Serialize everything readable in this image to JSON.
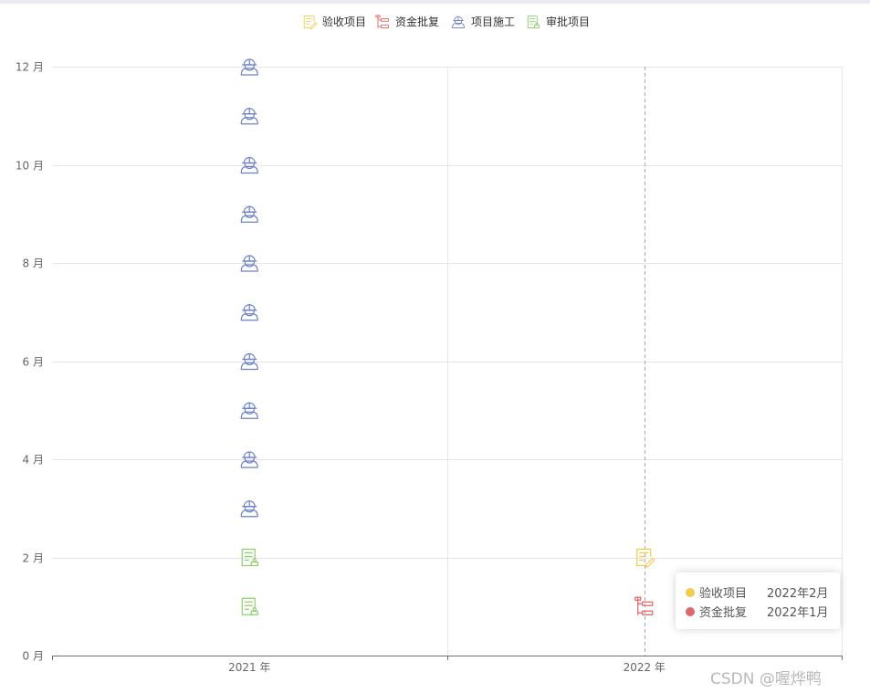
{
  "chart_data": {
    "type": "scatter",
    "legend": {
      "position": "top-center",
      "items": [
        {
          "name": "验收项目",
          "color": "#f1cc4a",
          "icon": "document-edit-icon"
        },
        {
          "name": "资金批复",
          "color": "#e06666",
          "icon": "tree-structure-icon"
        },
        {
          "name": "项目施工",
          "color": "#6b80cc",
          "icon": "worker-helmet-icon"
        },
        {
          "name": "审批项目",
          "color": "#8dcf6a",
          "icon": "document-approve-icon"
        }
      ]
    },
    "x_categories": [
      "2021 年",
      "2022 年"
    ],
    "y_axis": {
      "min": 0,
      "max": 12,
      "interval": 2,
      "unit": "月",
      "tick_labels": [
        "0 月",
        "2 月",
        "4 月",
        "6 月",
        "8 月",
        "10 月",
        "12 月"
      ]
    },
    "grid": true,
    "series": [
      {
        "name": "验收项目",
        "points": [
          {
            "x": "2022 年",
            "y": 2
          }
        ]
      },
      {
        "name": "资金批复",
        "points": [
          {
            "x": "2022 年",
            "y": 1
          }
        ]
      },
      {
        "name": "项目施工",
        "points": [
          {
            "x": "2021 年",
            "y": 3
          },
          {
            "x": "2021 年",
            "y": 4
          },
          {
            "x": "2021 年",
            "y": 5
          },
          {
            "x": "2021 年",
            "y": 6
          },
          {
            "x": "2021 年",
            "y": 7
          },
          {
            "x": "2021 年",
            "y": 8
          },
          {
            "x": "2021 年",
            "y": 9
          },
          {
            "x": "2021 年",
            "y": 10
          },
          {
            "x": "2021 年",
            "y": 11
          },
          {
            "x": "2021 年",
            "y": 12
          }
        ]
      },
      {
        "name": "审批项目",
        "points": [
          {
            "x": "2021 年",
            "y": 1
          },
          {
            "x": "2021 年",
            "y": 2
          }
        ]
      }
    ],
    "axis_pointer": {
      "x": "2022 年"
    }
  },
  "tooltip": {
    "rows": [
      {
        "name": "验收项目",
        "value": "2022年2月",
        "color": "#f1cc4a"
      },
      {
        "name": "资金批复",
        "value": "2022年1月",
        "color": "#e06666"
      }
    ]
  },
  "watermark": "CSDN @喔烨鸭"
}
